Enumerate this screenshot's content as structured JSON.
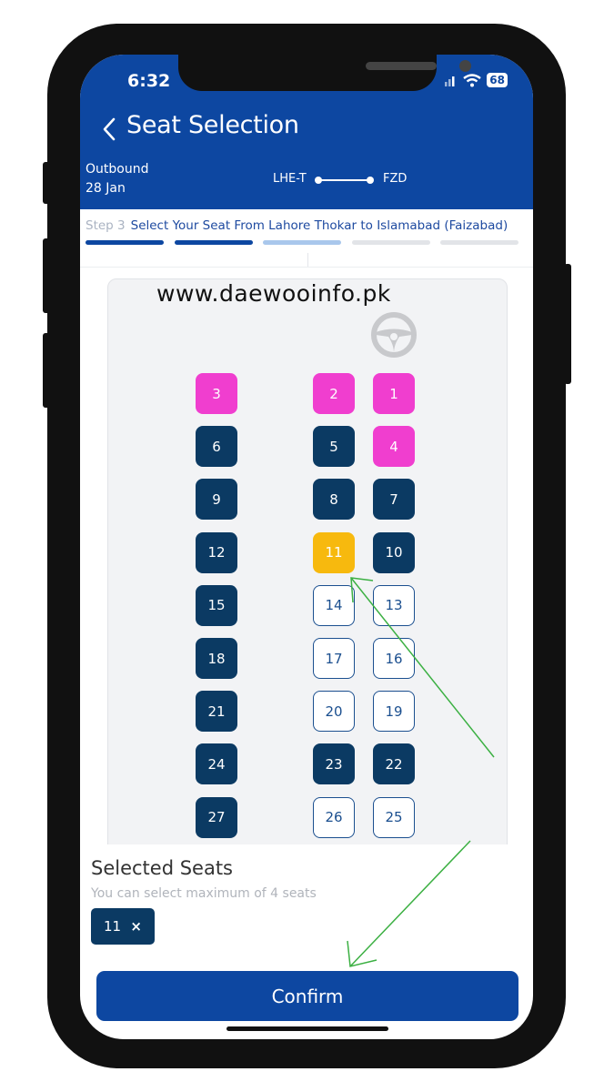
{
  "status_bar": {
    "time": "6:32",
    "battery": "68"
  },
  "header": {
    "title": "Seat Selection",
    "trip_label": "Outbound",
    "trip_date": "28 Jan",
    "route_from": "LHE-T",
    "route_to": "FZD"
  },
  "step": {
    "number": "Step 3",
    "text": "Select Your Seat From Lahore Thokar to Islamabad (Faizabad)",
    "segments": [
      "done",
      "done",
      "current",
      "pending",
      "pending"
    ]
  },
  "watermark": "www.daewooinfo.pk",
  "colors": {
    "primary": "#0d47a1",
    "booked": "#0b3a63",
    "female": "#f03ecf",
    "selected": "#f7b90e",
    "progress_done": "#0d47a1",
    "progress_current": "#a9c7ec",
    "progress_pending": "#e2e4e8",
    "arrow": "#3cb043"
  },
  "seats": [
    {
      "num": "3",
      "status": "female",
      "col": 0,
      "row": 0
    },
    {
      "num": "2",
      "status": "female",
      "col": 1,
      "row": 0
    },
    {
      "num": "1",
      "status": "female",
      "col": 2,
      "row": 0
    },
    {
      "num": "6",
      "status": "booked",
      "col": 0,
      "row": 1
    },
    {
      "num": "5",
      "status": "booked",
      "col": 1,
      "row": 1
    },
    {
      "num": "4",
      "status": "female",
      "col": 2,
      "row": 1
    },
    {
      "num": "9",
      "status": "booked",
      "col": 0,
      "row": 2
    },
    {
      "num": "8",
      "status": "booked",
      "col": 1,
      "row": 2
    },
    {
      "num": "7",
      "status": "booked",
      "col": 2,
      "row": 2
    },
    {
      "num": "12",
      "status": "booked",
      "col": 0,
      "row": 3
    },
    {
      "num": "11",
      "status": "selected",
      "col": 1,
      "row": 3
    },
    {
      "num": "10",
      "status": "booked",
      "col": 2,
      "row": 3
    },
    {
      "num": "15",
      "status": "booked",
      "col": 0,
      "row": 4
    },
    {
      "num": "14",
      "status": "available",
      "col": 1,
      "row": 4
    },
    {
      "num": "13",
      "status": "available",
      "col": 2,
      "row": 4
    },
    {
      "num": "18",
      "status": "booked",
      "col": 0,
      "row": 5
    },
    {
      "num": "17",
      "status": "available",
      "col": 1,
      "row": 5
    },
    {
      "num": "16",
      "status": "available",
      "col": 2,
      "row": 5
    },
    {
      "num": "21",
      "status": "booked",
      "col": 0,
      "row": 6
    },
    {
      "num": "20",
      "status": "available",
      "col": 1,
      "row": 6
    },
    {
      "num": "19",
      "status": "available",
      "col": 2,
      "row": 6
    },
    {
      "num": "24",
      "status": "booked",
      "col": 0,
      "row": 7
    },
    {
      "num": "23",
      "status": "booked",
      "col": 1,
      "row": 7
    },
    {
      "num": "22",
      "status": "booked",
      "col": 2,
      "row": 7
    },
    {
      "num": "27",
      "status": "booked",
      "col": 0,
      "row": 8
    },
    {
      "num": "26",
      "status": "available",
      "col": 1,
      "row": 8
    },
    {
      "num": "25",
      "status": "available",
      "col": 2,
      "row": 8
    }
  ],
  "selected_panel": {
    "title": "Selected Seats",
    "subtitle": "You can select maximum of 4 seats",
    "chips": [
      {
        "num": "11",
        "remove": "×"
      }
    ]
  },
  "confirm_label": "Confirm"
}
